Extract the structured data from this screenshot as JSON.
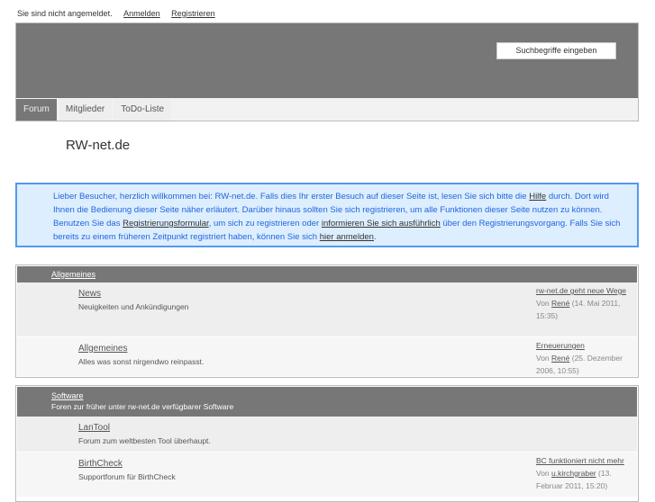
{
  "topbar": {
    "status": "Sie sind nicht angemeldet.",
    "login": "Anmelden",
    "register": "Registrieren"
  },
  "header": {
    "search_placeholder": "Suchbegriffe eingeben"
  },
  "nav": {
    "tabs": [
      {
        "label": "Forum"
      },
      {
        "label": "Mitglieder"
      },
      {
        "label": "ToDo-Liste"
      }
    ]
  },
  "site_title": "RW-net.de",
  "info": {
    "t1": "Lieber Besucher, herzlich willkommen bei: RW-net.de. Falls dies Ihr erster Besuch auf dieser Seite ist, lesen Sie sich bitte die ",
    "l1": "Hilfe",
    "t2": " durch. Dort wird Ihnen die Bedienung dieser Seite näher erläutert. Darüber hinaus sollten Sie sich registrieren, um alle Funktionen dieser Seite nutzen zu können. Benutzen Sie das ",
    "l2": "Registrierungsformular",
    "t3": ", um sich zu registrieren oder ",
    "l3": "informieren Sie sich ausführlich",
    "t4": " über den Registrierungsvorgang. Falls Sie sich bereits zu einem früheren Zeitpunkt registriert haben, können Sie sich ",
    "l4": "hier anmelden",
    "t5": "."
  },
  "categories": [
    {
      "title": "Allgemeines",
      "forums": [
        {
          "name": "News",
          "desc": "Neuigkeiten und Ankündigungen",
          "last_title": "rw-net.de geht neue Wege",
          "by": "Von",
          "user": "René",
          "date": "(14. Mai 2011, 15:35)"
        },
        {
          "name": "Allgemeines",
          "desc": "Alles was sonst nirgendwo reinpasst.",
          "last_title": "Erneuerungen",
          "by": "Von",
          "user": "René",
          "date": "(25. Dezember 2006, 10:55)"
        }
      ]
    },
    {
      "title": "Software",
      "desc": "Foren zur früher unter rw-net.de verfügbarer Software",
      "forums": [
        {
          "name": "LanTool",
          "desc": "Forum zum weltbesten Tool überhaupt."
        },
        {
          "name": "BirthCheck",
          "desc": "Supportforum für BirthCheck",
          "last_title": "BC funktioniert nicht mehr",
          "by": "Von",
          "user": "u.kirchgraber",
          "date": "(13. Februar 2011, 15:20)"
        }
      ]
    }
  ]
}
